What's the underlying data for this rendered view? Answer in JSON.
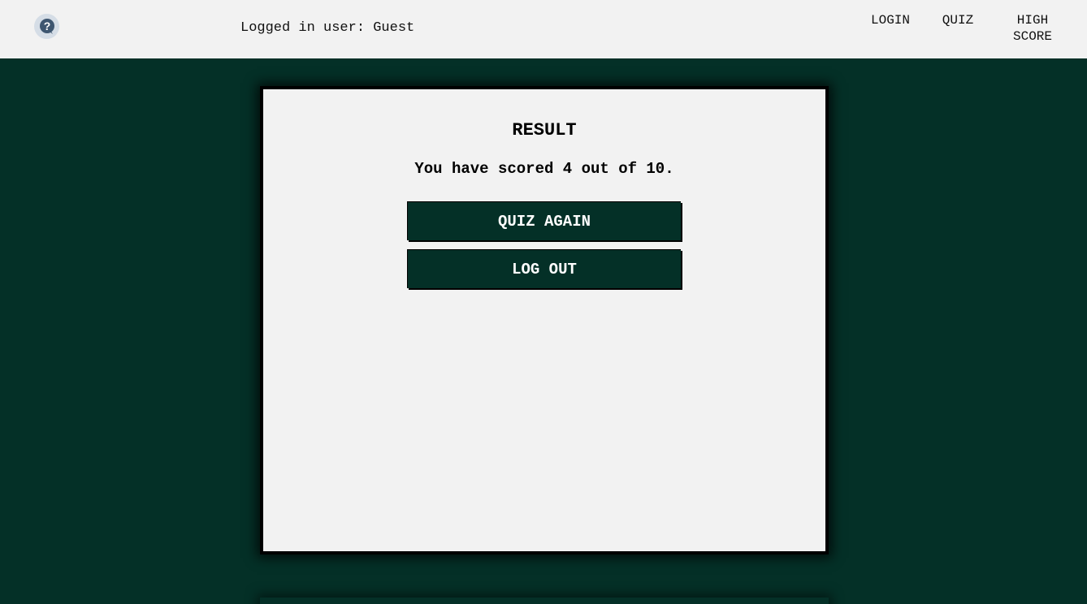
{
  "header": {
    "help_icon": "question-circle-icon",
    "user_label": "Logged in user: Guest",
    "nav": {
      "login": "LOGIN",
      "quiz": "QUIZ",
      "high_score_line1": "HIGH",
      "high_score_line2": "SCORE"
    }
  },
  "result": {
    "title": "RESULT",
    "score_text": "You have scored 4 out of 10.",
    "score": 4,
    "total": 10,
    "quiz_again_label": "QUIZ AGAIN",
    "logout_label": "LOG OUT"
  },
  "colors": {
    "background": "#043027",
    "header": "#f2f2f2",
    "panel": "#f2f2f2",
    "button": "#043027",
    "help_icon_bg": "#d5dde6",
    "help_icon_fg": "#3e5670"
  }
}
